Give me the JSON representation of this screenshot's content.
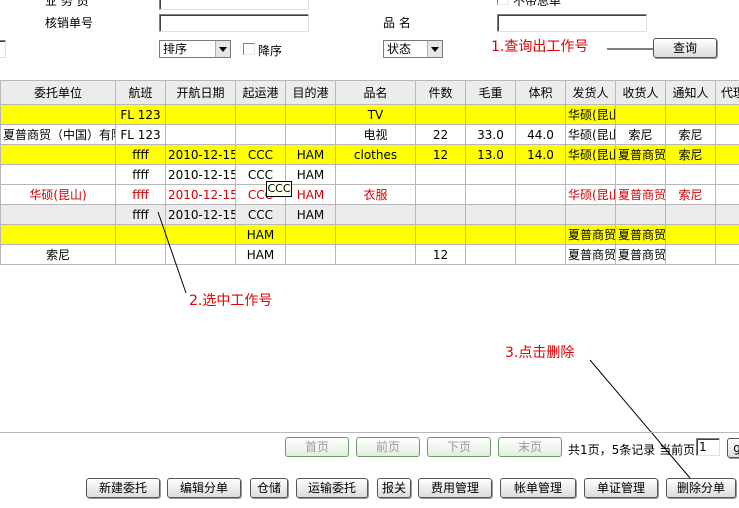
{
  "form": {
    "business_label": "业 务 员",
    "unsettled_label": "不带总单",
    "verify_label": "核销单号",
    "product_label": "品   名",
    "sort_select": "排序",
    "desc_label": "降序",
    "status_select": "状态",
    "query_button": "查询"
  },
  "table": {
    "headers": [
      "委托单位",
      "航班",
      "开航日期",
      "起运港",
      "目的港",
      "品名",
      "件数",
      "毛重",
      "体积",
      "发货人",
      "收货人",
      "通知人",
      "代理"
    ],
    "rows": [
      [
        "",
        "FL 123",
        "",
        "",
        "",
        "TV",
        "",
        "",
        "",
        "华硕(昆山",
        "",
        "",
        ""
      ],
      [
        "夏普商贸（中国）有限",
        "FL 123",
        "",
        "",
        "",
        "电视",
        "22",
        "33.0",
        "44.0",
        "华硕(昆山",
        "索尼",
        "索尼",
        ""
      ],
      [
        "",
        "ffff",
        "2010-12-15",
        "CCC",
        "HAM",
        "clothes",
        "12",
        "13.0",
        "14.0",
        "华硕(昆山",
        "夏普商贸",
        "索尼",
        ""
      ],
      [
        "",
        "ffff",
        "2010-12-15",
        "CCC",
        "HAM",
        "",
        "",
        "",
        "",
        "",
        "",
        "",
        ""
      ],
      [
        "华硕(昆山)",
        "ffff",
        "2010-12-15",
        "CCC",
        "HAM",
        "衣服",
        "",
        "",
        "",
        "华硕(昆山",
        "夏普商贸",
        "索尼",
        ""
      ],
      [
        "",
        "ffff",
        "2010-12-15",
        "CCC",
        "HAM",
        "",
        "",
        "",
        "",
        "",
        "",
        "",
        ""
      ],
      [
        "",
        "",
        "",
        "HAM",
        "",
        "",
        "",
        "",
        "",
        "夏普商贸",
        "夏普商贸",
        "",
        ""
      ],
      [
        "索尼",
        "",
        "",
        "HAM",
        "",
        "",
        "12",
        "",
        "",
        "夏普商贸",
        "夏普商贸",
        "",
        ""
      ]
    ],
    "tooltip": "CCC"
  },
  "annotations": {
    "step1": "1.查询出工作号",
    "step2": "2.选中工作号",
    "step3": "3.点击删除"
  },
  "pager": {
    "first": "首页",
    "prev": "前页",
    "next": "下页",
    "last": "末页",
    "summary": "共1页，5条记录 当前页",
    "current_page": "1",
    "go": "g"
  },
  "toolbar": {
    "new_order": "新建委托",
    "edit_order": "编辑分单",
    "storage": "仓储",
    "transport": "运输委托",
    "customs": "报关",
    "fees": "费用管理",
    "bills": "帐单管理",
    "documents": "单证管理",
    "delete_order": "删除分单"
  },
  "colors": {
    "highlight_row": "#ffff00",
    "annotation": "#e00000",
    "selected_text": "#d00000"
  }
}
